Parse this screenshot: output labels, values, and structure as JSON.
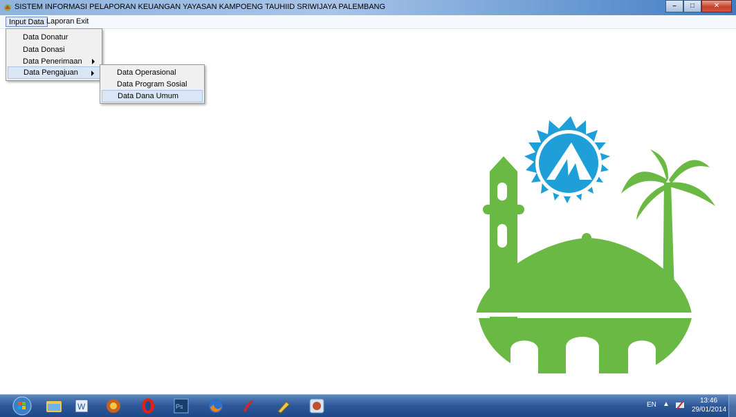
{
  "window": {
    "title": "SISTEM INFORMASI PELAPORAN KEUANGAN YAYASAN KAMPOENG TAUHIID SRIWIJAYA PALEMBANG"
  },
  "menubar": {
    "items": [
      "Input Data",
      "Laporan",
      "Exit"
    ]
  },
  "input_data_menu": {
    "items": [
      "Data Donatur",
      "Data Donasi",
      "Data Penerimaan",
      "Data Pengajuan"
    ]
  },
  "pengajuan_submenu": {
    "items": [
      "Data Operasional",
      "Data Program Sosial",
      "Data Dana Umum"
    ]
  },
  "taskbar": {
    "apps": [
      "start-orb",
      "windows-explorer",
      "microsoft-word",
      "age-of-empires",
      "opera",
      "photoshop",
      "firefox",
      "rational-rose",
      "tool",
      "app"
    ],
    "language": "EN",
    "time": "13:46",
    "date": "29/01/2014"
  },
  "colors": {
    "logo_green": "#6ab945",
    "logo_blue": "#1f9fd8"
  }
}
